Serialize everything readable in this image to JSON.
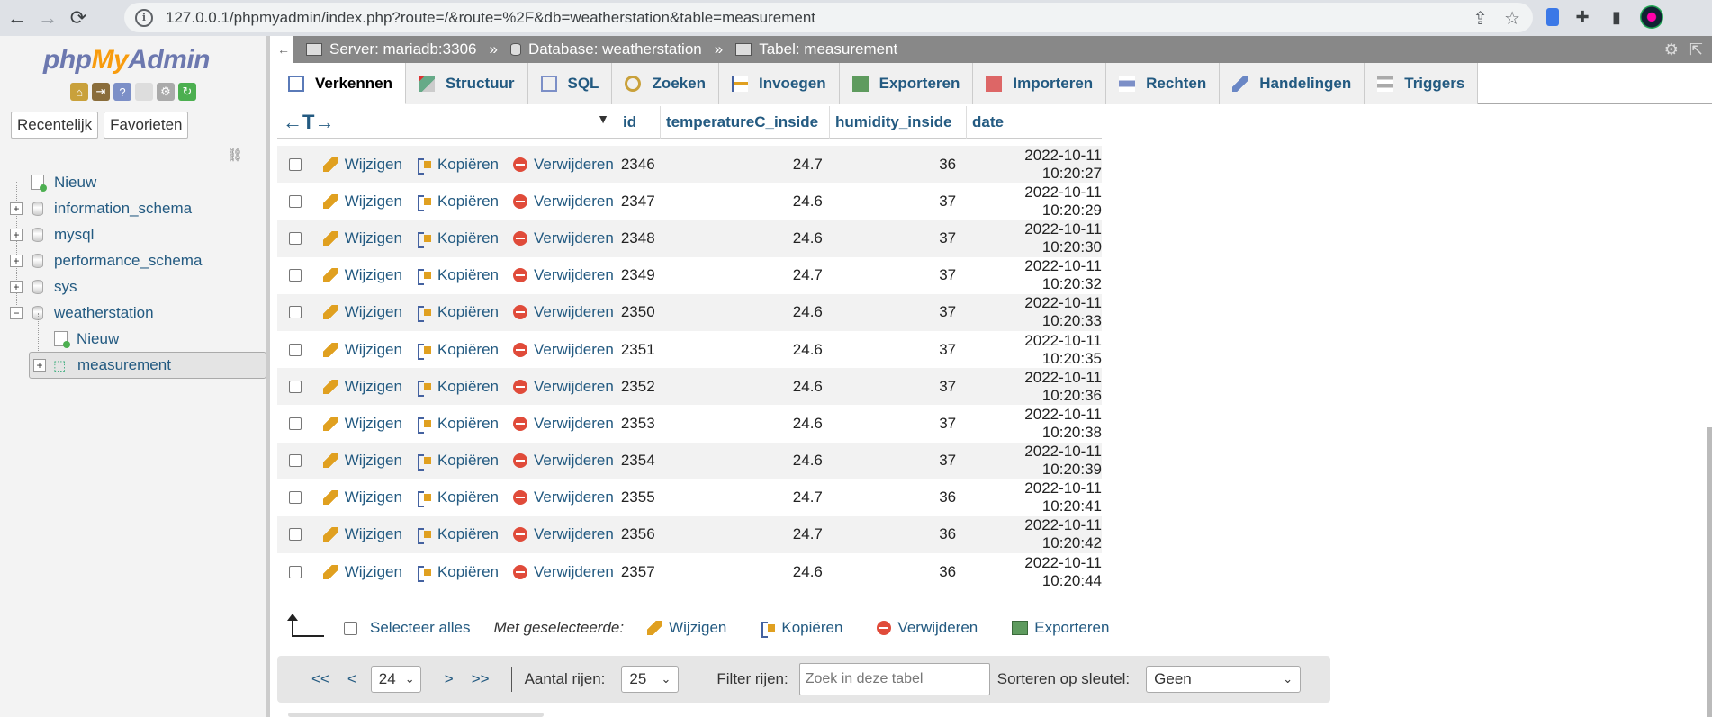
{
  "browser": {
    "url": "127.0.0.1/phpmyadmin/index.php?route=/&route=%2F&db=weatherstation&table=measurement"
  },
  "nav": {
    "logo": {
      "php": "php",
      "my": "My",
      "admin": "Admin"
    },
    "tabs": [
      "Recentelijk",
      "Favorieten"
    ],
    "tree": {
      "new_top": "Nieuw",
      "dbs": [
        "information_schema",
        "mysql",
        "performance_schema",
        "sys",
        "weatherstation"
      ],
      "new_sub": "Nieuw",
      "table": "measurement"
    }
  },
  "topbar": {
    "server": "Server: mariadb:3306",
    "database": "Database: weatherstation",
    "table": "Tabel: measurement",
    "sep": "»"
  },
  "tabs": [
    "Verkennen",
    "Structuur",
    "SQL",
    "Zoeken",
    "Invoegen",
    "Exporteren",
    "Importeren",
    "Rechten",
    "Handelingen",
    "Triggers"
  ],
  "table": {
    "arrows": "←T→",
    "columns": [
      "id",
      "temperatureC_inside",
      "humidity_inside",
      "date"
    ],
    "actions": {
      "edit": "Wijzigen",
      "copy": "Kopiëren",
      "delete": "Verwijderen"
    },
    "rows": [
      {
        "id": "2346",
        "temp": "24.7",
        "hum": "36",
        "date": "2022-10-11 10:20:27"
      },
      {
        "id": "2347",
        "temp": "24.6",
        "hum": "37",
        "date": "2022-10-11 10:20:29"
      },
      {
        "id": "2348",
        "temp": "24.6",
        "hum": "37",
        "date": "2022-10-11 10:20:30"
      },
      {
        "id": "2349",
        "temp": "24.7",
        "hum": "37",
        "date": "2022-10-11 10:20:32"
      },
      {
        "id": "2350",
        "temp": "24.6",
        "hum": "37",
        "date": "2022-10-11 10:20:33"
      },
      {
        "id": "2351",
        "temp": "24.6",
        "hum": "37",
        "date": "2022-10-11 10:20:35"
      },
      {
        "id": "2352",
        "temp": "24.6",
        "hum": "37",
        "date": "2022-10-11 10:20:36"
      },
      {
        "id": "2353",
        "temp": "24.6",
        "hum": "37",
        "date": "2022-10-11 10:20:38"
      },
      {
        "id": "2354",
        "temp": "24.6",
        "hum": "37",
        "date": "2022-10-11 10:20:39"
      },
      {
        "id": "2355",
        "temp": "24.7",
        "hum": "36",
        "date": "2022-10-11 10:20:41"
      },
      {
        "id": "2356",
        "temp": "24.7",
        "hum": "36",
        "date": "2022-10-11 10:20:42"
      },
      {
        "id": "2357",
        "temp": "24.6",
        "hum": "36",
        "date": "2022-10-11 10:20:44"
      }
    ]
  },
  "with_selected": {
    "select_all": "Selecteer alles",
    "label": "Met geselecteerde:",
    "edit": "Wijzigen",
    "copy": "Kopiëren",
    "delete": "Verwijderen",
    "export": "Exporteren"
  },
  "pager": {
    "first": "<<",
    "prev": "<",
    "page": "24",
    "next": ">",
    "last": ">>",
    "rows_label": "Aantal rijen:",
    "rows_value": "25",
    "filter_label": "Filter rijen:",
    "filter_placeholder": "Zoek in deze tabel",
    "sort_label": "Sorteren op sleutel:",
    "sort_value": "Geen"
  }
}
